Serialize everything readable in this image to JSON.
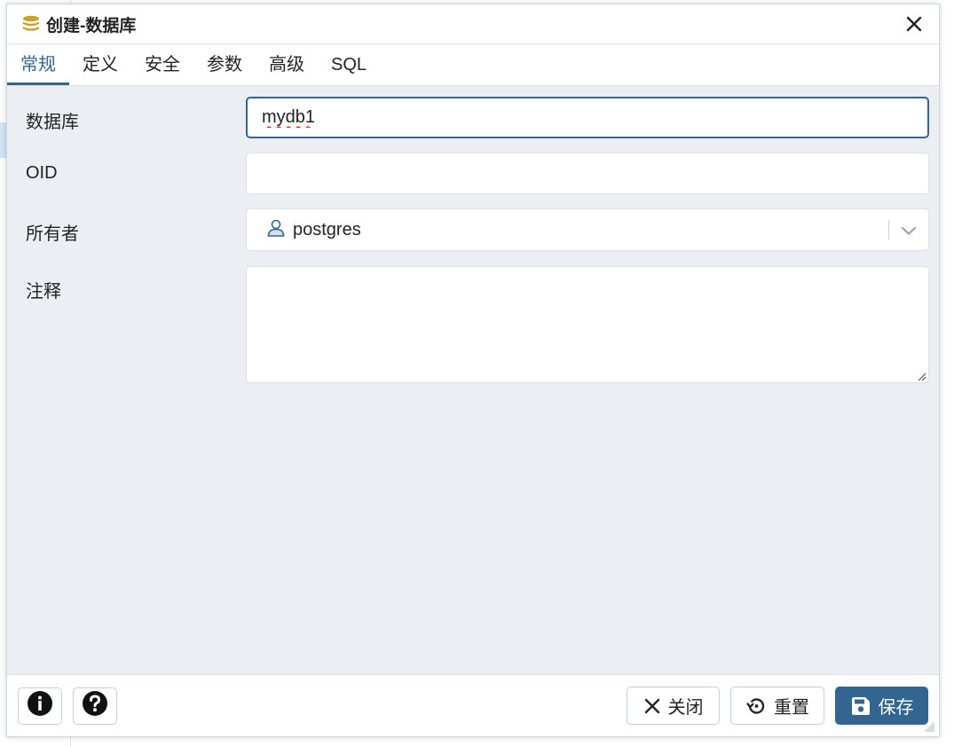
{
  "dialog": {
    "title": "创建-数据库",
    "title_icon": "database-icon",
    "close_icon": "close-icon"
  },
  "tabs": [
    {
      "label": "常规",
      "active": true
    },
    {
      "label": "定义",
      "active": false
    },
    {
      "label": "安全",
      "active": false
    },
    {
      "label": "参数",
      "active": false
    },
    {
      "label": "高级",
      "active": false
    },
    {
      "label": "SQL",
      "active": false
    }
  ],
  "form": {
    "database": {
      "label": "数据库",
      "value": "mydb1"
    },
    "oid": {
      "label": "OID",
      "value": ""
    },
    "owner": {
      "label": "所有者",
      "value": "postgres",
      "icon": "user-icon",
      "caret_icon": "chevron-down-icon"
    },
    "comment": {
      "label": "注释",
      "value": ""
    }
  },
  "footer": {
    "info_icon": "info-icon",
    "help_icon": "help-icon",
    "close_label": "关闭",
    "reset_label": "重置",
    "save_label": "保存"
  },
  "colors": {
    "accent": "#326690",
    "body_bg": "#ebeef3",
    "border": "#dde1e6"
  }
}
